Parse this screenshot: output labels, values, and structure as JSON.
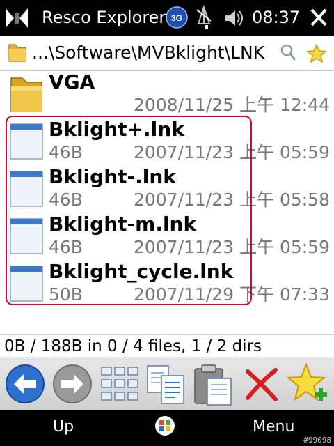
{
  "status_bar": {
    "app_title": "Resco Explorer",
    "network": "3G",
    "time": "08:37"
  },
  "path_bar": {
    "path": "...\\Software\\MVBklight\\LNK"
  },
  "files": [
    {
      "name": "VGA",
      "type": "folder",
      "size": "",
      "date": "2008/11/25 上午 12:44"
    },
    {
      "name": "Bklight+.lnk",
      "type": "file",
      "size": "46B",
      "date": "2007/11/23 上午 05:59"
    },
    {
      "name": "Bklight-.lnk",
      "type": "file",
      "size": "46B",
      "date": "2007/11/23 上午 05:58"
    },
    {
      "name": "Bklight-m.lnk",
      "type": "file",
      "size": "46B",
      "date": "2007/11/23 上午 05:59"
    },
    {
      "name": "Bklight_cycle.lnk",
      "type": "file",
      "size": "50B",
      "date": "2007/11/29 下午 07:33"
    }
  ],
  "summary": "0B / 188B in 0 / 4 files, 1 / 2 dirs",
  "toolbar_icons": [
    "back-arrow-icon",
    "forward-arrow-icon",
    "grid-view-icon",
    "copy-icon",
    "paste-icon",
    "delete-icon",
    "add-favorite-icon"
  ],
  "softkeys": {
    "left": "Up",
    "right": "Menu"
  },
  "watermark": "#99098",
  "colors": {
    "selection": "#c8102e",
    "bar_bg": "#000000",
    "toolbar_bg": "#d8d8d8"
  }
}
